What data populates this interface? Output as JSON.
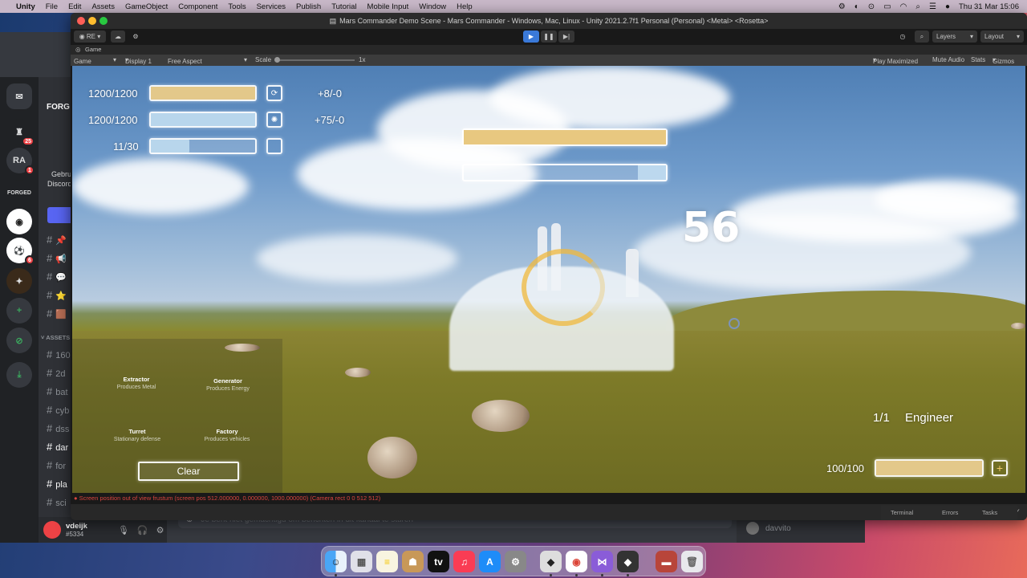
{
  "menubar": {
    "app": "Unity",
    "items": [
      "File",
      "Edit",
      "Assets",
      "GameObject",
      "Component",
      "Tools",
      "Services",
      "Publish",
      "Tutorial",
      "Mobile Input",
      "Window",
      "Help"
    ],
    "clock": "Thu 31 Mar  15:06"
  },
  "discord": {
    "server_label": "FORG",
    "server_name": "FORGED",
    "welcome_line1": "Gebru",
    "welcome_line2": "Discord",
    "section": "ASSETS",
    "channels": [
      "160",
      "2d",
      "bat",
      "cyb",
      "dss",
      "dar",
      "for",
      "pla",
      "sci"
    ],
    "guild_initials": "RA",
    "badges": [
      "25",
      "1",
      "6"
    ],
    "user": {
      "name": "vdeijk",
      "tag": "#5334"
    },
    "input_placeholder": "Je bent niet gemachtigd om berichten in dit kanaal te sturen",
    "members": [
      "davvito"
    ]
  },
  "unity": {
    "title": "Mars Commander Demo Scene - Mars Commander - Windows, Mac, Linux - Unity 2021.2.7f1 Personal (Personal) <Metal> <Rosetta>",
    "account": "RE",
    "layers_label": "Layers",
    "layout_label": "Layout",
    "tab_label": "Game",
    "gamebar": {
      "view": "Game",
      "display": "Display 1",
      "aspect": "Free Aspect",
      "scale_label": "Scale",
      "scale_value": "1x",
      "play_maximized": "Play Maximized",
      "mute": "Mute Audio",
      "stats": "Stats",
      "gizmos": "Gizmos"
    },
    "error_message": "Screen position out of view frustum (screen pos 512.000000, 0.000000, 1000.000000) (Camera rect 0 0 512 512)",
    "status_tabs": [
      "Terminal",
      "Errors",
      "Tasks"
    ]
  },
  "hud": {
    "resources": [
      {
        "label": "1200/1200",
        "rate": "+8/-0",
        "fill": 1.0,
        "color": "#e3c88a"
      },
      {
        "label": "1200/1200",
        "rate": "+75/-0",
        "fill": 1.0,
        "color": "#b8d6ec"
      },
      {
        "label": "11/30",
        "rate": "",
        "fill": 0.37,
        "color": "#b8d6ec"
      }
    ],
    "target_health_fill": 1.0,
    "target_progress_fill": 0.14,
    "timer": "56",
    "build_options": [
      {
        "name": "Extractor",
        "desc": "Produces Metal"
      },
      {
        "name": "Generator",
        "desc": "Produces Energy"
      },
      {
        "name": "Turret",
        "desc": "Stationary defense"
      },
      {
        "name": "Factory",
        "desc": "Produces vehicles"
      }
    ],
    "clear_label": "Clear",
    "unit_count": "1/1",
    "unit_name": "Engineer",
    "unit_health": "100/100",
    "unit_health_fill": 1.0,
    "add_icon": "plus-icon"
  },
  "colors": {
    "metal": "#e3c88a",
    "energy": "#b8d6ec",
    "error": "#d9453f",
    "discord_red": "#ed4245"
  }
}
